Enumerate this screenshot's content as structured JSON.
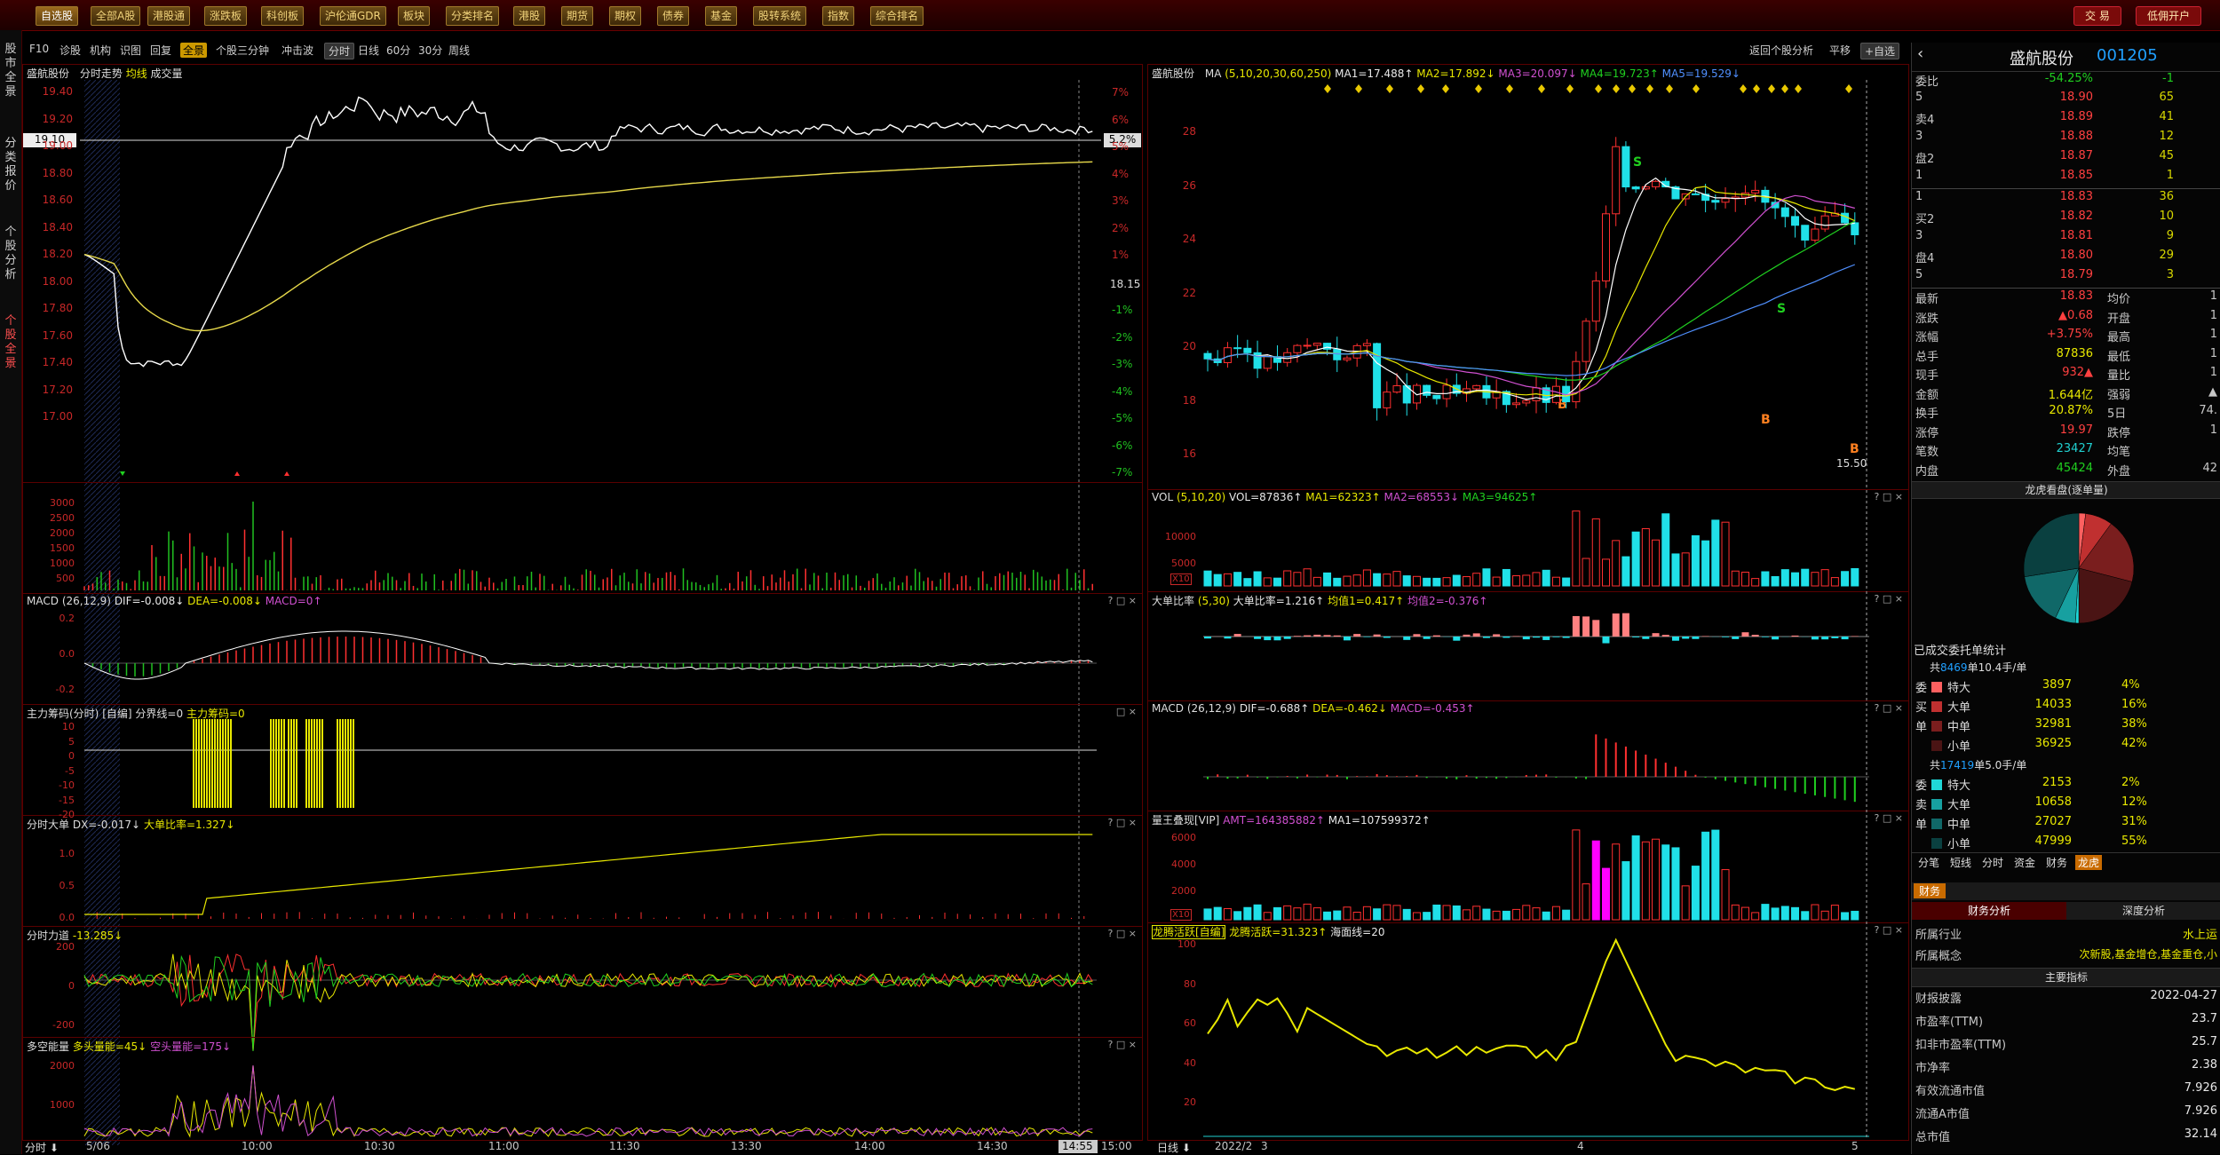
{
  "topbar": {
    "buttons": [
      "自选股",
      "全部A股",
      "港股通",
      "涨跌板",
      "科创板",
      "沪伦通GDR",
      "板块",
      "分类排名",
      "港股",
      "期货",
      "期权",
      "债券",
      "基金",
      "股转系统",
      "指数",
      "综合排名"
    ],
    "trade_button": "交 易",
    "open_account_button": "低佣开户"
  },
  "left_tabs": [
    "股市全景",
    "分类报价",
    "个股分析",
    "个股全景"
  ],
  "toolbar2": {
    "left_items": [
      "F10",
      "诊股",
      "机构",
      "识图",
      "回复",
      "全景",
      "个股三分钟",
      "冲击波"
    ],
    "period_items": [
      "分时",
      "日线",
      "60分",
      "30分",
      "周线"
    ],
    "right_items": [
      "返回个股分析",
      "平移",
      "+自选"
    ]
  },
  "intraday": {
    "title_name": "盛航股份",
    "title_items": [
      "分时走势",
      "均线",
      "成交量"
    ],
    "price_labels": [
      "19.40",
      "19.20",
      "19.00",
      "18.80",
      "18.60",
      "18.40",
      "18.20",
      "18.00",
      "17.80",
      "17.60",
      "17.40",
      "17.20",
      "17.00"
    ],
    "pct_labels": [
      "7%",
      "6%",
      "5%",
      "4%",
      "3%",
      "2%",
      "1%",
      "-1%",
      "-2%",
      "-3%",
      "-4%",
      "-5%",
      "-6%",
      "-7%"
    ],
    "current_price_tag": "19.10",
    "current_pct_tag": "5.2%",
    "prev_close_label": "18.15",
    "time_labels": [
      "5/06",
      "10:00",
      "10:30",
      "11:00",
      "11:30",
      "13:30",
      "14:00",
      "14:30",
      "14:55",
      "15:00"
    ],
    "left_footer": "分时",
    "vol_labels": [
      "3000",
      "2500",
      "2000",
      "1500",
      "1000",
      "500"
    ],
    "macd_title": [
      "MACD",
      "(26,12,9)",
      "DIF=-0.008↓",
      "DEA=-0.008↓",
      "MACD=0↑"
    ],
    "macd_labels": [
      "0.2",
      "0.0",
      "-0.2"
    ],
    "zhuli_title": [
      "主力筹码(分时)",
      "[自编]",
      "分界线=0",
      "主力筹码=0"
    ],
    "zhuli_labels": [
      "10",
      "5",
      "0",
      "-5",
      "-10",
      "-15",
      "-20"
    ],
    "dadan_title": [
      "分时大单",
      "DX=-0.017↓",
      "大单比率=1.327↓"
    ],
    "dadan_labels": [
      "1.0",
      "0.5",
      "0.0"
    ],
    "lidao_title": [
      "分时力道",
      "-13.285↓"
    ],
    "lidao_labels": [
      "200",
      "0",
      "-200"
    ],
    "duokong_title": [
      "多空能量",
      "多头量能=45↓",
      "空头量能=175↓"
    ],
    "duokong_labels": [
      "2000",
      "1000"
    ]
  },
  "daily": {
    "title": [
      "盛航股份",
      "MA",
      "(5,10,20,30,60,250)",
      "MA1=17.488↑",
      "MA2=17.892↓",
      "MA3=20.097↓",
      "MA4=19.723↑",
      "MA5=19.529↓"
    ],
    "price_labels": [
      "28",
      "26",
      "24",
      "22",
      "20",
      "18",
      "16"
    ],
    "low_tag": "15.50",
    "signal_labels": [
      "S",
      "S",
      "B",
      "B",
      "B"
    ],
    "vol_title": [
      "VOL",
      "(5,10,20)",
      "VOL=87836↑",
      "MA1=62323↑",
      "MA2=68553↓",
      "MA3=94625↑"
    ],
    "vol_labels": [
      "10000",
      "5000"
    ],
    "vol_unit": "X10",
    "dadan_title": [
      "大单比率",
      "(5,30)",
      "大单比率=1.216↑",
      "均值1=0.417↑",
      "均值2=-0.376↑"
    ],
    "macd_title": [
      "MACD",
      "(26,12,9)",
      "DIF=-0.688↑",
      "DEA=-0.462↓",
      "MACD=-0.453↑"
    ],
    "liangwang_title": [
      "量王叠现[VIP]",
      "AMT=164385882↑",
      "MA1=107599372↑"
    ],
    "liangwang_labels": [
      "6000",
      "4000",
      "2000"
    ],
    "liangwang_unit": "X10",
    "longteng_title": [
      "龙腾活跃[自编]",
      "龙腾活跃=31.323↑",
      "海面线=20"
    ],
    "longteng_labels": [
      "100",
      "80",
      "60",
      "40",
      "20"
    ],
    "x_labels": [
      "2022/2",
      "3",
      "4",
      "5"
    ],
    "footer": "日线"
  },
  "quote": {
    "name": "盛航股份",
    "code": "001205",
    "weibi_label": "委比",
    "weibi": "-54.25%",
    "weicha": "-1",
    "sell": [
      {
        "label": "5",
        "price": "18.90",
        "vol": "65"
      },
      {
        "label": "卖4",
        "price": "18.89",
        "vol": "41"
      },
      {
        "label": "3",
        "price": "18.88",
        "vol": "12"
      },
      {
        "label": "盘2",
        "price": "18.87",
        "vol": "45"
      },
      {
        "label": "1",
        "price": "18.85",
        "vol": "1"
      }
    ],
    "buy": [
      {
        "label": "1",
        "price": "18.83",
        "vol": "36"
      },
      {
        "label": "买2",
        "price": "18.82",
        "vol": "10"
      },
      {
        "label": "3",
        "price": "18.81",
        "vol": "9"
      },
      {
        "label": "盘4",
        "price": "18.80",
        "vol": "29"
      },
      {
        "label": "5",
        "price": "18.79",
        "vol": "3"
      }
    ],
    "stats": [
      {
        "k": "最新",
        "v": "18.83",
        "k2": "均价",
        "v2": "1"
      },
      {
        "k": "涨跌",
        "v": "▲0.68",
        "k2": "开盘",
        "v2": "1"
      },
      {
        "k": "涨幅",
        "v": "+3.75%",
        "k2": "最高",
        "v2": "1"
      },
      {
        "k": "总手",
        "v": "87836",
        "k2": "最低",
        "v2": "1"
      },
      {
        "k": "现手",
        "v": "932▲",
        "k2": "量比",
        "v2": "1"
      },
      {
        "k": "金额",
        "v": "1.644亿",
        "k2": "强弱",
        "v2": "▲"
      },
      {
        "k": "换手",
        "v": "20.87%",
        "k2": "5日",
        "v2": "74."
      },
      {
        "k": "涨停",
        "v": "19.97",
        "k2": "跌停",
        "v2": "1"
      },
      {
        "k": "笔数",
        "v": "23427",
        "k2": "均笔",
        "v2": ""
      },
      {
        "k": "内盘",
        "v": "45424",
        "k2": "外盘",
        "v2": "42"
      }
    ],
    "longhu_title": "龙虎看盘(逐单量)",
    "deal_stats_title": "已成交委托单统计",
    "buy_group_title_pre": "共",
    "buy_group_count": "8469",
    "buy_group_title_post": "单10.4手/单",
    "buy_rows": [
      {
        "side": "委",
        "label": "特大",
        "vol": "3897",
        "pct": "4%",
        "color": "#ff6060"
      },
      {
        "side": "买",
        "label": "大单",
        "vol": "14033",
        "pct": "16%",
        "color": "#c03030"
      },
      {
        "side": "单",
        "label": "中单",
        "vol": "32981",
        "pct": "38%",
        "color": "#7a1e1e"
      },
      {
        "side": "",
        "label": "小单",
        "vol": "36925",
        "pct": "42%",
        "color": "#4a1414"
      }
    ],
    "sell_group_title_pre": "共",
    "sell_group_count": "17419",
    "sell_group_title_post": "单5.0手/单",
    "sell_rows": [
      {
        "side": "委",
        "label": "特大",
        "vol": "2153",
        "pct": "2%",
        "color": "#20d8d8"
      },
      {
        "side": "卖",
        "label": "大单",
        "vol": "10658",
        "pct": "12%",
        "color": "#17a0a0"
      },
      {
        "side": "单",
        "label": "中单",
        "vol": "27027",
        "pct": "31%",
        "color": "#106868"
      },
      {
        "side": "",
        "label": "小单",
        "vol": "47999",
        "pct": "55%",
        "color": "#0a4040"
      }
    ],
    "tabs": [
      "分笔",
      "短线",
      "分时",
      "资金",
      "财务",
      "龙虎"
    ],
    "finance_tab": "财务",
    "finance_subtabs": [
      "财务分析",
      "深度分析"
    ],
    "industry_label": "所属行业",
    "industry_value": "水上运",
    "concept_label": "所属概念",
    "concept_value": "次新股,基金增仓,基金重仓,小",
    "main_index_title": "主要指标",
    "fin_rows": [
      {
        "k": "财报披露",
        "v": "2022-04-27"
      },
      {
        "k": "市盈率(TTM)",
        "v": "23.7"
      },
      {
        "k": "扣非市盈率(TTM)",
        "v": "25.7"
      },
      {
        "k": "市净率",
        "v": "2.38"
      },
      {
        "k": "有效流通市值",
        "v": "7.926"
      },
      {
        "k": "流通A市值",
        "v": "7.926"
      },
      {
        "k": "总市值",
        "v": "32.14"
      }
    ]
  }
}
